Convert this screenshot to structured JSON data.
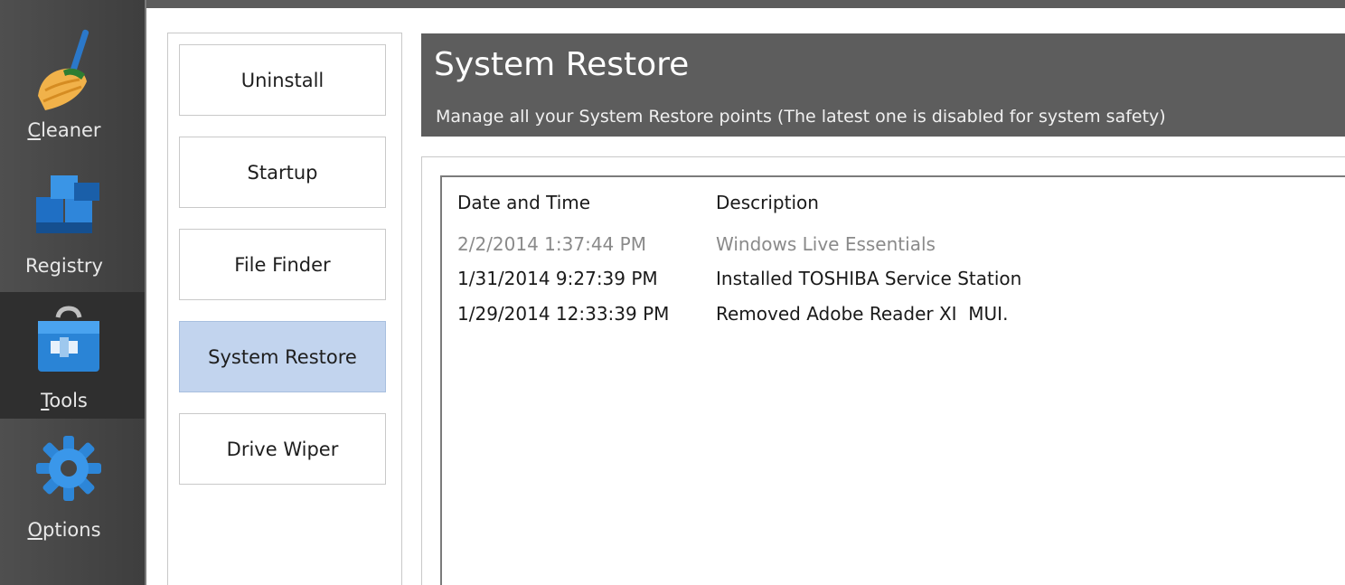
{
  "nav": {
    "items": [
      {
        "label_first": "C",
        "label_rest": "leaner",
        "icon": "broom-icon"
      },
      {
        "label_first": "",
        "label_rest": "Registry",
        "icon": "registry-cubes-icon"
      },
      {
        "label_first": "T",
        "label_rest": "ools",
        "icon": "toolbox-icon"
      },
      {
        "label_first": "O",
        "label_rest": "ptions",
        "icon": "gear-icon"
      }
    ],
    "active": "Tools"
  },
  "tools_menu": {
    "items": [
      "Uninstall",
      "Startup",
      "File Finder",
      "System Restore",
      "Drive Wiper"
    ],
    "selected": "System Restore"
  },
  "header": {
    "title": "System Restore",
    "subtitle": "Manage all your System Restore points (The latest one is disabled for system safety)"
  },
  "restore_list": {
    "columns": [
      "Date and Time",
      "Description"
    ],
    "rows": [
      {
        "date": "2/2/2014 1:37:44 PM",
        "description": "Windows Live Essentials",
        "disabled": true
      },
      {
        "date": "1/31/2014 9:27:39 PM",
        "description": "Installed TOSHIBA Service Station",
        "disabled": false
      },
      {
        "date": "1/29/2014 12:33:39 PM",
        "description": "Removed Adobe Reader XI  MUI.",
        "disabled": false
      }
    ]
  },
  "colors": {
    "rail": "#454545",
    "header": "#5d5d5d",
    "selected_tool": "#c2d4ee",
    "disabled_text": "#8a8a8a"
  }
}
